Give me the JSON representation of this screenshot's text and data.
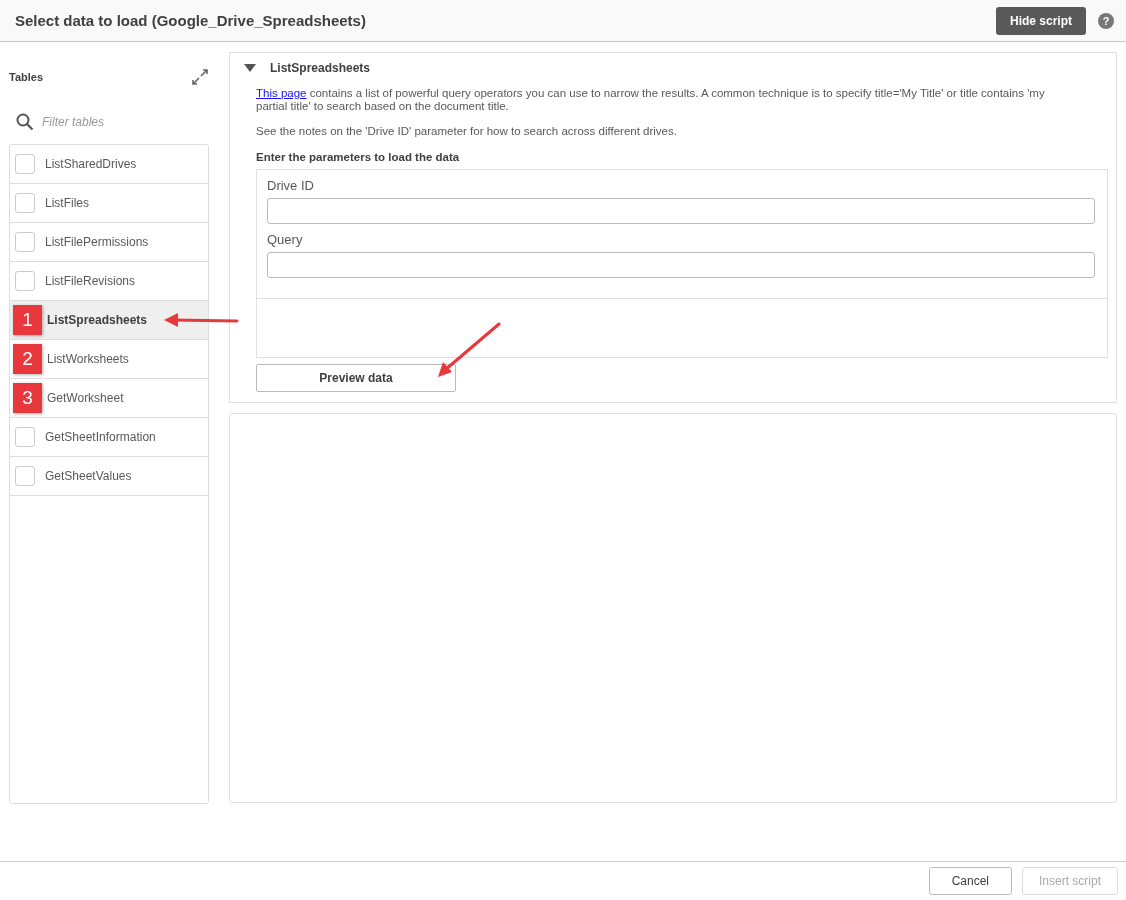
{
  "window": {
    "title": "Select data to load (Google_Drive_Spreadsheets)"
  },
  "header_buttons": {
    "hide_script": "Hide script",
    "help": "?"
  },
  "sidebar": {
    "title": "Tables",
    "filter": {
      "placeholder": "Filter tables"
    },
    "items": [
      {
        "label": "ListSharedDrives",
        "selected": false,
        "checked": false
      },
      {
        "label": "ListFiles",
        "selected": false,
        "checked": false
      },
      {
        "label": "ListFilePermissions",
        "selected": false,
        "checked": false
      },
      {
        "label": "ListFileRevisions",
        "selected": false,
        "checked": false
      },
      {
        "label": "ListSpreadsheets",
        "selected": true,
        "badge": "1"
      },
      {
        "label": "ListWorksheets",
        "selected": false,
        "badge": "2"
      },
      {
        "label": "GetWorksheet",
        "selected": false,
        "badge": "3"
      },
      {
        "label": "GetSheetInformation",
        "selected": false,
        "checked": false
      },
      {
        "label": "GetSheetValues",
        "selected": false,
        "checked": false
      }
    ]
  },
  "detail": {
    "title": "ListSpreadsheets",
    "expanded": true,
    "link": "This page",
    "description": " contains a list of powerful query operators you can use to narrow the results. A common technique is to specify title='My Title' or title contains 'my partial title' to search based on the document title.",
    "note": "See the notes on the 'Drive ID' parameter for how to search across different drives.",
    "params_heading": "Enter the parameters to load the data",
    "params": [
      {
        "label": "Drive ID"
      },
      {
        "label": "Query"
      }
    ],
    "preview_button": "Preview data"
  },
  "footer": {
    "buttons": [
      {
        "label": "Cancel",
        "disabled": false
      },
      {
        "label": "Insert script",
        "disabled": true
      }
    ]
  }
}
